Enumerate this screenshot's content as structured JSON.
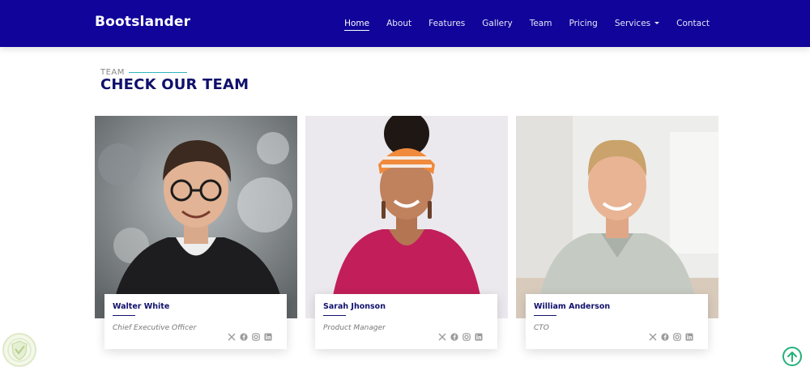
{
  "header": {
    "brand": "Bootslander",
    "nav": [
      {
        "label": "Home",
        "active": true
      },
      {
        "label": "About"
      },
      {
        "label": "Features"
      },
      {
        "label": "Gallery"
      },
      {
        "label": "Team"
      },
      {
        "label": "Pricing"
      },
      {
        "label": "Services",
        "dropdown": true
      },
      {
        "label": "Contact"
      }
    ]
  },
  "section": {
    "eyebrow": "TEAM",
    "title": "CHECK OUR TEAM"
  },
  "team": [
    {
      "name": "Walter White",
      "role": "Chief Executive Officer",
      "photo": "portrait-man-glasses-black-hoodie"
    },
    {
      "name": "Sarah Jhonson",
      "role": "Product Manager",
      "photo": "portrait-woman-headscarf-magenta-top"
    },
    {
      "name": "William Anderson",
      "role": "CTO",
      "photo": "portrait-man-blond-grey-polo"
    }
  ],
  "social_icons": [
    "x-icon",
    "facebook-icon",
    "instagram-icon",
    "linkedin-icon"
  ],
  "colors": {
    "header_bg": "#10049a",
    "title": "#10106c",
    "accent_line": "#2fb4c0",
    "back_to_top": "#25b07a"
  }
}
